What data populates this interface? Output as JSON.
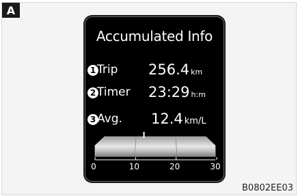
{
  "figure": {
    "tag": "A",
    "code": "B0802EE03"
  },
  "panel": {
    "title": "Accumulated Info",
    "rows": [
      {
        "number": "1",
        "label": "Trip",
        "value": "256.4",
        "unit": "km"
      },
      {
        "number": "2",
        "label": "Timer",
        "value": "23:29",
        "unit": "h:m"
      },
      {
        "number": "3",
        "label": "Avg.",
        "value": "12.4",
        "unit": "km/L"
      }
    ],
    "gauge": {
      "scale_labels": [
        "0",
        "10",
        "20",
        "30"
      ],
      "scale_min": 0,
      "scale_max": 30,
      "indicator_value": 12.4
    }
  }
}
